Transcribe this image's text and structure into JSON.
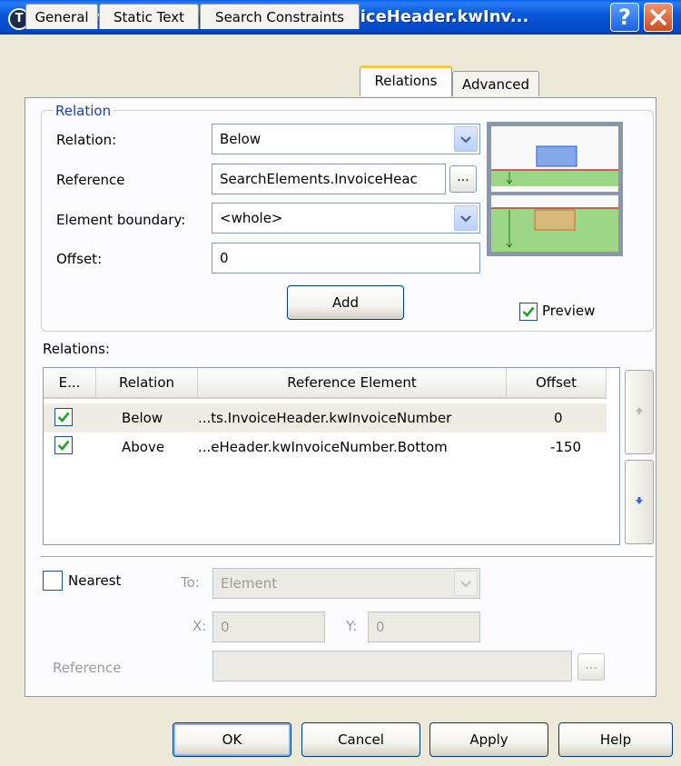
{
  "window": {
    "title": "Properties of SearchElements.InvoiceHeader.kwInv...",
    "app_icon_letter": "T"
  },
  "tabs": [
    {
      "label": "General",
      "active": false
    },
    {
      "label": "Static Text",
      "active": false
    },
    {
      "label": "Search Constraints",
      "active": false
    },
    {
      "label": "Relations",
      "active": true
    },
    {
      "label": "Advanced",
      "active": false
    }
  ],
  "relation_group": {
    "legend": "Relation",
    "relation_label": "Relation:",
    "relation_value": "Below",
    "reference_label": "Reference",
    "reference_value": "SearchElements.InvoiceHeac",
    "browse_label": "...",
    "boundary_label": "Element boundary:",
    "boundary_value": "<whole>",
    "offset_label": "Offset:",
    "offset_value": "0",
    "add_label": "Add",
    "preview_label": "Preview",
    "preview_checked": true
  },
  "relations_list": {
    "label": "Relations:",
    "columns": [
      "E...",
      "Relation",
      "Reference Element",
      "Offset"
    ],
    "rows": [
      {
        "enabled": true,
        "relation": "Below",
        "reference": "...ts.InvoiceHeader.kwInvoiceNumber",
        "offset": "0"
      },
      {
        "enabled": true,
        "relation": "Above",
        "reference": "...eHeader.kwInvoiceNumber.Bottom",
        "offset": "-150"
      }
    ]
  },
  "nearest": {
    "label": "Nearest",
    "checked": false,
    "to_label": "To:",
    "to_value": "Element",
    "x_label": "X:",
    "x_value": "0",
    "y_label": "Y:",
    "y_value": "0",
    "reference_label": "Reference",
    "reference_value": "",
    "browse_label": "..."
  },
  "buttons": {
    "ok": "OK",
    "cancel": "Cancel",
    "apply": "Apply",
    "help": "Help"
  },
  "colors": {
    "titlebar": "#0a58dc",
    "dialog_bg": "#ece9d8",
    "active_tab_highlight": "#ffc83c",
    "checkmark": "#21a121",
    "preview_green": "#9dd687",
    "preview_blue_box": "#82a8e8",
    "preview_orange_box": "#d6b87a"
  }
}
